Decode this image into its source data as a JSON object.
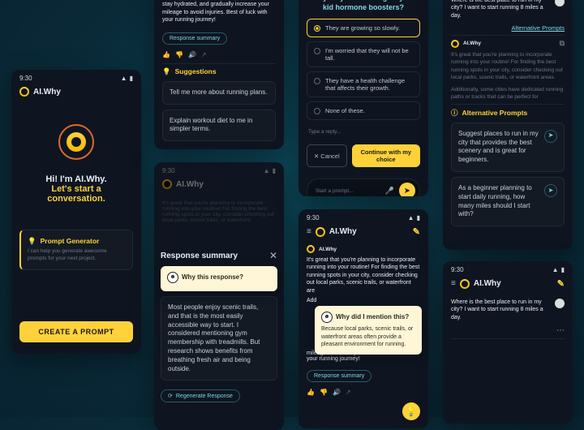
{
  "common": {
    "time": "9:30",
    "brand": "AI.Why"
  },
  "p1": {
    "greet1": "Hi! I'm AI.Why.",
    "greet2": "Let's start a conversation.",
    "pg_title": "Prompt Generator",
    "pg_sub": "I can help you generate awesome prompts for your next project.",
    "cta": "CREATE A PROMPT"
  },
  "p2": {
    "msg": "Remember to invest in good running shoes, stay hydrated, and gradually increase your mileage to avoid injuries. Best of luck with your running journey!",
    "chip": "Response summary",
    "sugg_title": "Suggestions",
    "s1": "Tell me more about running plans.",
    "s2": "Explain workout diet to me in simpler terms."
  },
  "p3": {
    "modal_title": "Response summary",
    "q": "Why this response?",
    "body": "Most people enjoy scenic trails, and that is the most easily accessible way to start. I considered mentioning gym membership with treadmills. But research shows benefits from breathing fresh air and being outside.",
    "regen": "Regenerate Response"
  },
  "p4": {
    "question": "Why do you want to give your kid hormone boosters?",
    "o1": "They are growing so slowly.",
    "o2": "I'm worried that they will not be tall.",
    "o3": "They have a health challenge that affects their growth.",
    "o4": "None of these.",
    "reply_ph": "Type a reply...",
    "cancel": "Cancel",
    "cont": "Continue with my choice",
    "prompt_ph": "Start a prompt..."
  },
  "p5": {
    "body": "It's great that you're planning to incorporate running into your routine! For finding the best running spots in your city, consider checking out local parks, scenic trails, or waterfront are",
    "add": "Add",
    "pop_title": "Why did I mention this?",
    "pop_body": "Because local parks, scenic trails, or waterfront areas often provide a pleasant environment for running.",
    "tail": "mileage to avoid injuries. Best of luck with your running journey!",
    "chip": "Response summary"
  },
  "p6": {
    "user_msg": "Where is the best place to run in my city? I want to start running 8 miles a day.",
    "alt_link": "Alternative Prompts",
    "alt_title": "Alternative Prompts",
    "a1": "Suggest places to run in my city that provides the best scenery and is great for beginners.",
    "a2": "As a beginner planning to start daily running, how many miles should I start with?"
  },
  "p7": {
    "user_msg": "Where is the best place to run in my city? I want to start running 8 miles a day."
  }
}
